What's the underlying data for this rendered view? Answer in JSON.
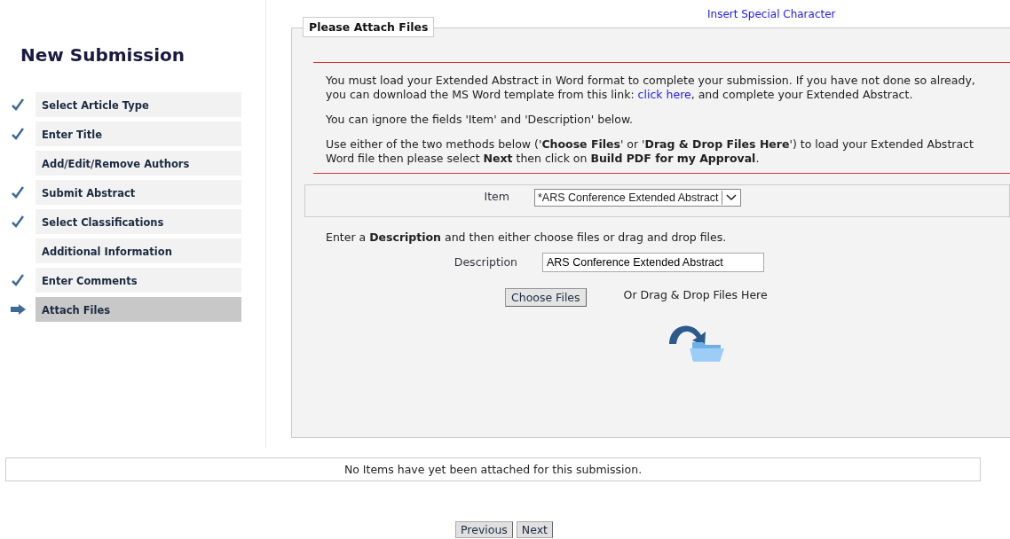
{
  "sidebar": {
    "title": "New Submission",
    "steps": [
      {
        "label": "Select Article Type",
        "completed": true,
        "selected": false
      },
      {
        "label": "Enter Title",
        "completed": true,
        "selected": false
      },
      {
        "label": "Add/Edit/Remove Authors",
        "completed": false,
        "selected": false
      },
      {
        "label": "Submit Abstract",
        "completed": true,
        "selected": false
      },
      {
        "label": "Select Classifications",
        "completed": true,
        "selected": false
      },
      {
        "label": "Additional Information",
        "completed": false,
        "selected": false
      },
      {
        "label": "Enter Comments",
        "completed": true,
        "selected": false
      },
      {
        "label": "Attach Files",
        "selected": true
      }
    ]
  },
  "top_link": "Insert Special Character",
  "panel": {
    "legend": "Please Attach Files",
    "intro": {
      "before": "You must load your Extended Abstract in Word format to complete your submission. If you have not done so already, you can download the MS Word template from this link: ",
      "link": "click here",
      "after": ", and complete your Extended Abstract."
    },
    "paragraphs": [
      "You can ignore the fields 'Item' and 'Description' below.",
      "Use either of the two methods below ('**Choose Files**' or '**Drag & Drop Files Here**') to load your Extended Abstract Word file then please select **Next** then click on **Build PDF for my Approval**."
    ],
    "item": {
      "label": "Item",
      "value": "*ARS Conference Extended Abstract"
    },
    "instruction": "Enter a **Description** and then either choose files or drag and drop files.",
    "description": {
      "label": "Description",
      "value": "ARS Conference Extended Abstract"
    },
    "choose_button": "Choose Files",
    "drop_label": "Or Drag & Drop Files Here"
  },
  "attachments_message": "No Items have yet been attached for this submission.",
  "buttons": [
    "Previous",
    "Next"
  ]
}
